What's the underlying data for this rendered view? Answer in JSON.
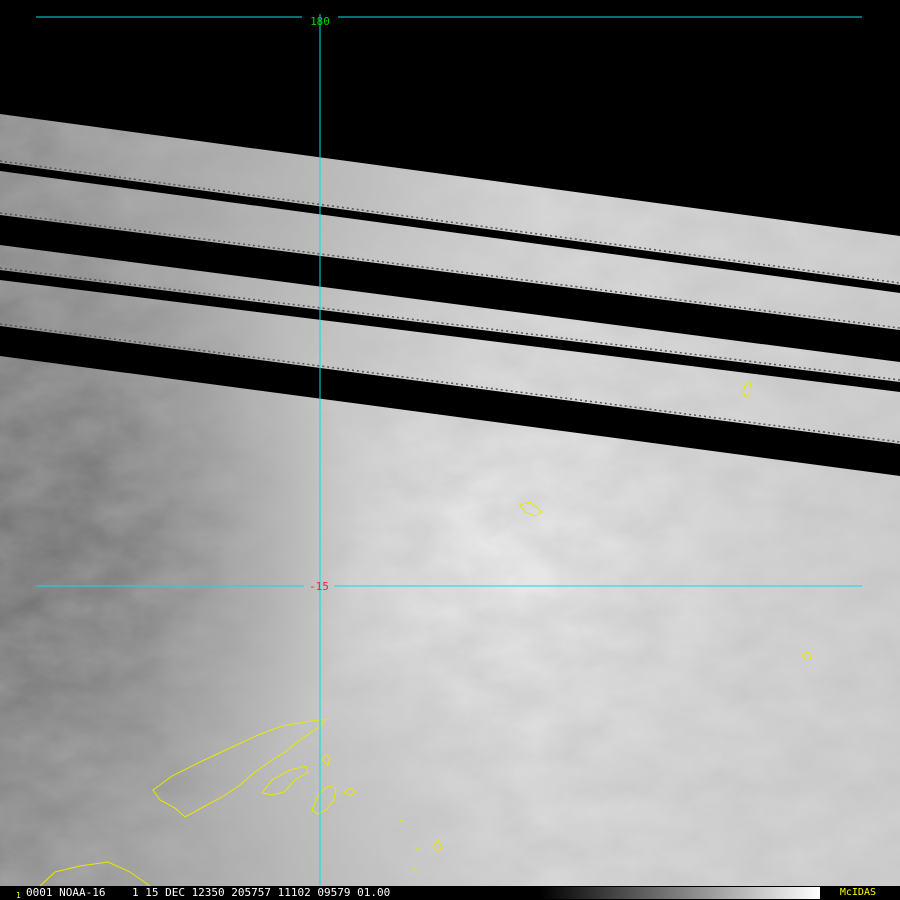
{
  "map": {
    "satellite": "NOAA-16",
    "grid": {
      "longitude_label": "180",
      "latitude_label": "-15"
    },
    "colors": {
      "grid_line": "#00e0e0",
      "longitude_label": "#00d000",
      "latitude_label": "#ff2020",
      "coastline": "#e8e800",
      "background": "#000000"
    }
  },
  "status_bar": {
    "frame_number": "1",
    "text": "0001 NOAA-16    1 15 DEC 12350 205757 11102 09579 01.00",
    "brand": "McIDAS"
  }
}
